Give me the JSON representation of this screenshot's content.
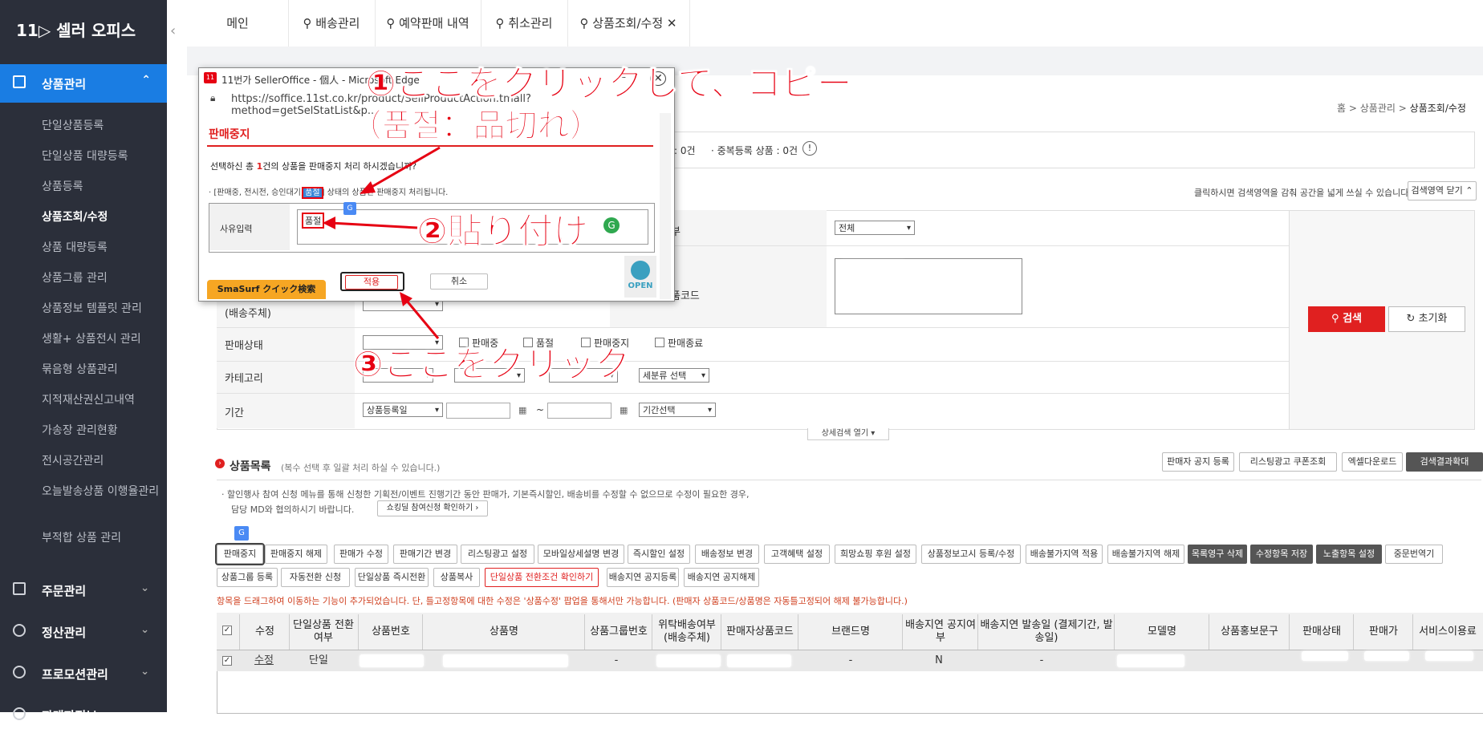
{
  "sidebar": {
    "logo": "11▷ 셀러 오피스",
    "active_menu": "상품관리",
    "items": [
      "단일상품등록",
      "단일상품 대량등록",
      "상품등록",
      "상품조회/수정",
      "상품 대량등록",
      "상품그룹 관리",
      "상품정보 템플릿 관리",
      "생활+ 상품전시 관리",
      "묶음형 상품관리",
      "지적재산권신고내역",
      "가송장 관리현황",
      "전시공간관리",
      "오늘발송상품 이행율관리",
      "부적합 상품 관리"
    ],
    "groups": [
      "주문관리",
      "정산관리",
      "프로모션관리",
      "판매자정보"
    ]
  },
  "tabs": [
    "메인",
    "배송관리",
    "예약판매 내역",
    "취소관리",
    "상품조회/수정"
  ],
  "breadcrumb": {
    "home": "홈",
    "sep": ">",
    "level1": "상품관리",
    "level2": "상품조회/수정"
  },
  "summary": {
    "count_text": ": 0건",
    "dup_label": "· 중복등록 상품 : 0건"
  },
  "search_area": {
    "toggle_hint": "클릭하시면 검색영역을 감춰 공간을 넓게 쓰실 수 있습니다.",
    "toggle_button": "검색영역 닫기 ⌃",
    "row_labels": [
      "(배송주체)",
      "판매상태",
      "카테고리",
      "기간"
    ],
    "right_label": "부",
    "right_label2": "품코드",
    "select_all": "전체",
    "status_options": [
      "판매중",
      "품절",
      "판매중지",
      "판매종료"
    ],
    "category_select": "세분류 선택",
    "period_select": "상품등록일",
    "period_range": "기간선택",
    "search_btn": "검색",
    "reset_btn": "초기화",
    "detail_toggle": "상세검색 열기 ▾"
  },
  "list": {
    "title": "상품목록",
    "subtitle": "(복수 선택 후 일괄 처리 하실 수 있습니다.)",
    "top_buttons": [
      "판매자 공지 등록",
      "리스팅광고 쿠폰조회",
      "엑셀다운로드",
      "검색결과확대"
    ],
    "notice1": "· 할인행사 참여 신청 메뉴를 통해 신청한 기획전/이벤트 진행기간 동안 판매가, 기본즉시할인, 배송비를 수정할 수 없으므로 수정이 필요한 경우,",
    "notice2": "담당 MD와 협의하시기 바랍니다.",
    "notice_btn": "쇼킹딜 참여신청 확인하기 ›",
    "buttons_row1": [
      "판매중지",
      "판매중지 해제",
      "판매가 수정",
      "판매기간 변경",
      "리스팅광고 설정",
      "모바일상세설명 변경",
      "즉시할인 설정",
      "배송정보 변경",
      "고객혜택 설정",
      "희망쇼핑 후원 설정",
      "상품정보고시 등록/수정",
      "배송불가지역 적용",
      "배송불가지역 해제",
      "목록영구 삭제",
      "수정항목 저장",
      "노출항목 설정",
      "중문번역기"
    ],
    "buttons_row2": [
      "상품그룹 등록",
      "자동전환 신청",
      "단일상품 즉시전환",
      "상품복사",
      "단일상품 전환조건 확인하기",
      "배송지연 공지등록",
      "배송지연 공지해제"
    ],
    "drag_notice": "항목을 드래그하여 이동하는 기능이 추가되었습니다. 단, 틀고정항목에 대한 수정은 '상품수정' 팝업을 통해서만 가능합니다. (판매자 상품코드/상품명은 자동틀고정되어 해제 불가능합니다.)",
    "columns": [
      "수정",
      "단일상품 전환여부",
      "상품번호",
      "상품명",
      "상품그룹번호",
      "위탁배송여부 (배송주체)",
      "판매자상품코드",
      "브랜드명",
      "배송지연 공지여부",
      "배송지연 발송일 (결제기간, 발송일)",
      "모델명",
      "상품홍보문구",
      "판매상태",
      "판매가",
      "서비스이용료"
    ],
    "row": {
      "edit": "수정",
      "single": "단일",
      "group": "-",
      "brand": "-",
      "delay": "N",
      "delay_date": "-"
    }
  },
  "popup": {
    "window_title": "11번가 SellerOffice - 個人 - Microsoft Edge",
    "url": "https://soffice.11st.co.kr/product/SellProductAction.tmall?method=getSelStatList&p...",
    "header": "판매중지",
    "question_prefix": "선택하신 총 ",
    "question_count": "1",
    "question_suffix": "건의 상품을 판매중지 처리 하시겠습니까?",
    "note_prefix": "· [판매중, 전시전, 승인대기,",
    "note_highlight": "품절",
    "note_suffix": "] 상태의 상품만 판매중지 처리됩니다.",
    "reason_label": "사유입력",
    "reason_value": "품절",
    "apply_btn": "적용",
    "cancel_btn": "취소",
    "smasurf": "SmaSurf クイック検索",
    "open_badge": "OPEN"
  },
  "annotations": {
    "step1": "①ここをクリックして、コピー",
    "step1_sub": "（품절：品切れ）",
    "step2": "②貼り付け",
    "step3": "③ここをクリック"
  },
  "colors": {
    "sidebar_bg": "#2b2f3a",
    "active_blue": "#1a7de3",
    "brand_red": "#e60012",
    "search_red": "#e02020"
  }
}
